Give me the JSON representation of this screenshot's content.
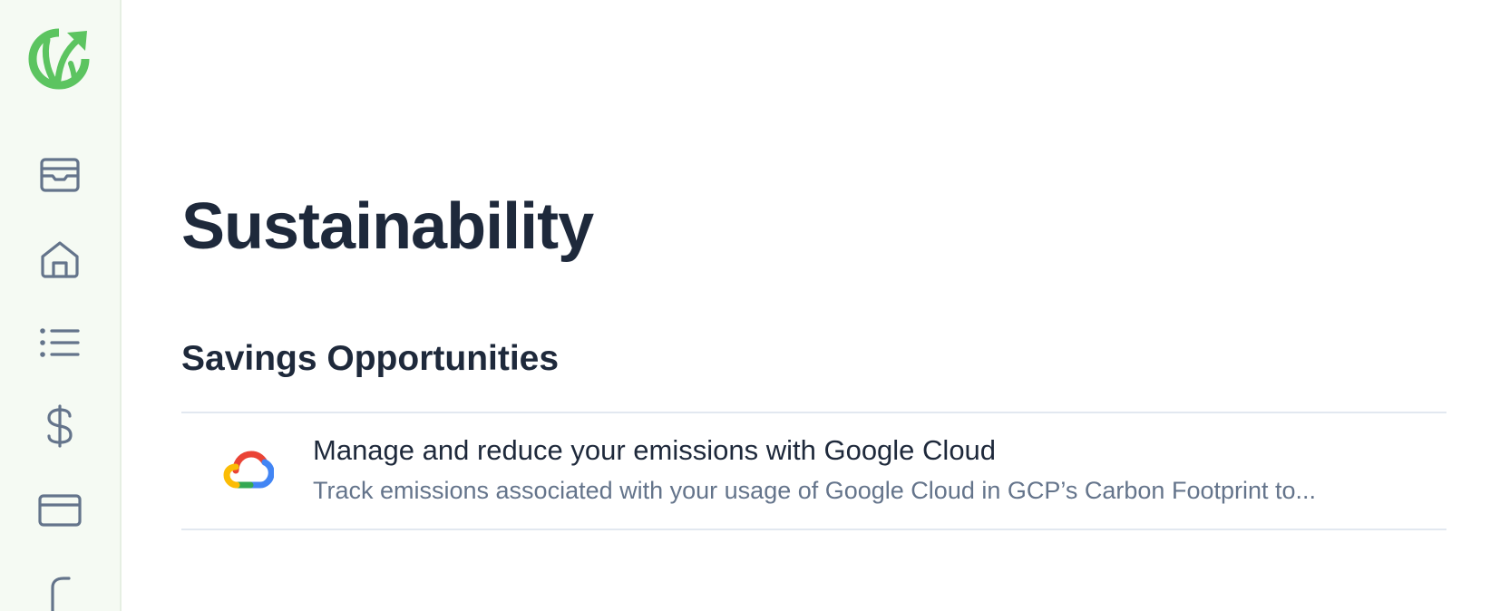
{
  "colors": {
    "brand_green": "#5cc460",
    "icon_gray": "#64748b",
    "title": "#1e293b",
    "muted": "#64748b",
    "sidebar_bg": "#f5faf3"
  },
  "sidebar": {
    "logo": "leaf-arrow-logo",
    "items": [
      {
        "icon": "inbox-icon"
      },
      {
        "icon": "home-icon"
      },
      {
        "icon": "list-icon"
      },
      {
        "icon": "dollar-icon"
      },
      {
        "icon": "credit-card-icon"
      },
      {
        "icon": "partial-icon"
      }
    ]
  },
  "main": {
    "page_title": "Sustainability",
    "sections": [
      {
        "title": "Savings Opportunities",
        "items": [
          {
            "icon": "google-cloud-icon",
            "title": "Manage and reduce your emissions with Google Cloud",
            "description": "Track emissions associated with your usage of Google Cloud in GCP’s Carbon Footprint to..."
          }
        ]
      }
    ]
  }
}
